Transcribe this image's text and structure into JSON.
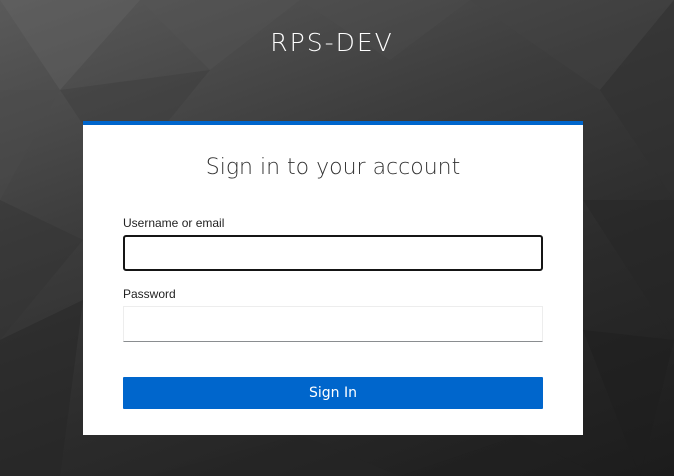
{
  "realm": {
    "title": "RPS-DEV"
  },
  "login_card": {
    "title": "Sign in to your account",
    "username": {
      "label": "Username or email",
      "value": "",
      "placeholder": ""
    },
    "password": {
      "label": "Password",
      "value": "",
      "placeholder": ""
    },
    "submit_label": "Sign In"
  },
  "colors": {
    "accent": "#0066cc",
    "card_background": "#ffffff",
    "page_background": "#2b2b2b",
    "title_text": "#ffffff"
  }
}
